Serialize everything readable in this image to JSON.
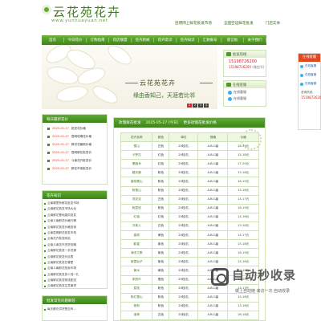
{
  "header": {
    "logo_text": "云花苑花卉",
    "logo_url": "www.yunhuayuan.net",
    "top_links": [
      "昆明网上鲜花批发市场",
      "全国空运鲜花批发",
      "门店实体"
    ]
  },
  "nav": [
    "首页",
    "今日花价",
    "订购指南",
    "花店联盟",
    "花卉新闻",
    "花卉常识",
    "花卉知识",
    "汇款账号",
    "留言板",
    "关于我们"
  ],
  "banner": {
    "title": "云花苑花卉",
    "subtitle": "缘由香知己，天涯若比邻",
    "dots": [
      "1",
      "2",
      "3",
      "4"
    ]
  },
  "contact": {
    "title": "批发热线",
    "phone1": "15198726200",
    "phone2": "15198726200",
    "phone2_note": "(微信号)"
  },
  "qq": {
    "title": "在线客服",
    "items": [
      "在线客服",
      "在线客服"
    ]
  },
  "left_news": {
    "title": "每日最新花价",
    "items": [
      {
        "date": "2025-01-27",
        "text": "批发花价格"
      },
      {
        "date": "2025-01-27",
        "text": "昆明玫瑰花价格"
      },
      {
        "date": "2025-01-27",
        "text": "鲜切花最新价格"
      },
      {
        "date": "2025-01-27",
        "text": "昆明鲜花批发价"
      },
      {
        "date": "2025-01-27",
        "text": "斗南花卉批发价"
      },
      {
        "date": "2025-01-27",
        "text": "鲜花市场批发价"
      }
    ]
  },
  "left_articles": {
    "title": "花卉知识",
    "items": [
      "云南哪里有鲜花批发市场",
      "云南鲜花批发市场大全",
      "云南鲜花基地直供批发",
      "云南斗南鲜花价格行情",
      "云南鲜花批发价格查询",
      "云南昆明鲜花批发市场",
      "云南花卉批发网站",
      "云南斗南花市进货攻略",
      "云南鲜花批发一手货源",
      "云南鲜花批发价目表",
      "云南鲜花批发在哪里",
      "云南斗南鲜花拍卖市场",
      "云南鲜花批发多少钱一扎",
      "云南鲜花批发物流配送",
      "云南鲜花批发注意事项"
    ]
  },
  "left_bottom": {
    "title": "批发常见问题解答",
    "first_item": "每天都在供货是否有..."
  },
  "price_table": {
    "header": {
      "title": "玫瑰鲜花批发",
      "date": "2025-05-27 (今日)",
      "note": "更多玫瑰花批发价格"
    },
    "columns": [
      "花卉名称",
      "颜色",
      "单位",
      "规格",
      "价格"
    ],
    "rows": [
      {
        "name": "雪山",
        "color": "白色",
        "unit": "20枝/扎",
        "grade": "A-B-C级",
        "price": "16-19元"
      },
      {
        "name": "卡罗拉",
        "color": "红色",
        "unit": "20枝/扎",
        "grade": "A-B-C级",
        "price": "15-18元"
      },
      {
        "name": "黑魔术",
        "color": "红色",
        "unit": "20枝/扎",
        "grade": "A-B-C级",
        "price": "17-20元"
      },
      {
        "name": "戴安娜",
        "color": "粉色",
        "unit": "20枝/扎",
        "grade": "A-B-C级",
        "price": "15-18元"
      },
      {
        "name": "蜜桃雪山",
        "color": "粉色",
        "unit": "20枝/扎",
        "grade": "A-B-C级",
        "price": "16-19元"
      },
      {
        "name": "粉雪山",
        "color": "粉色",
        "unit": "20枝/扎",
        "grade": "A-B-C级",
        "price": "15-18元"
      },
      {
        "name": "坦尼克",
        "color": "白色",
        "unit": "20枝/扎",
        "grade": "A-B-C级",
        "price": "14-17元"
      },
      {
        "name": "粉荔枝",
        "color": "粉色",
        "unit": "20枝/扎",
        "grade": "A-B-C级",
        "price": "16-19元"
      },
      {
        "name": "红袖",
        "color": "红色",
        "unit": "20枝/扎",
        "grade": "A-B-C级",
        "price": "14-16元"
      },
      {
        "name": "冷美人",
        "color": "白色",
        "unit": "20枝/扎",
        "grade": "A-B-C级",
        "price": "13-16元"
      },
      {
        "name": "香槟",
        "color": "黄色",
        "unit": "20枝/扎",
        "grade": "A-B-C级",
        "price": "14-17元"
      },
      {
        "name": "影星",
        "color": "紫色",
        "unit": "20枝/扎",
        "grade": "A-B-C级",
        "price": "15-18元"
      },
      {
        "name": "海洋之歌",
        "color": "紫色",
        "unit": "20枝/扎",
        "grade": "A-B-C级",
        "price": "16-19元"
      },
      {
        "name": "紫霞仙子",
        "color": "紫色",
        "unit": "20枝/扎",
        "grade": "A-B-C级",
        "price": "15-18元"
      },
      {
        "name": "黄冰",
        "color": "黄色",
        "unit": "20枝/扎",
        "grade": "A-B-C级",
        "price": "13-16元"
      },
      {
        "name": "朱丽叶",
        "color": "橙色",
        "unit": "20枝/扎",
        "grade": "A-B-C级",
        "price": "17-20元"
      },
      {
        "name": "荔枝",
        "color": "粉色",
        "unit": "20枝/扎",
        "grade": "A-B-C级",
        "price": "14-17元"
      },
      {
        "name": "粉红雪山",
        "color": "粉色",
        "unit": "20枝/扎",
        "grade": "A-B-C级",
        "price": "15-18元"
      },
      {
        "name": "艳粉",
        "color": "粉色",
        "unit": "20枝/扎",
        "grade": "A-B-C级",
        "price": "13-16元"
      },
      {
        "name": "洛神",
        "color": "白色",
        "unit": "20枝/扎",
        "grade": "A-B-C级",
        "price": "16-18元"
      }
    ]
  },
  "float_panel": {
    "title": "在线客服",
    "items": [
      "在线客服",
      "在线客服",
      "在线客服"
    ],
    "tel_label": "咨询热线",
    "tel": "15198726200"
  },
  "watermark": {
    "title": "自动秒收录",
    "subtitle": "做上自动链·来访一次·自动收录"
  },
  "colors": {
    "brand_green": "#3c8418",
    "accent_red": "#e34622"
  }
}
